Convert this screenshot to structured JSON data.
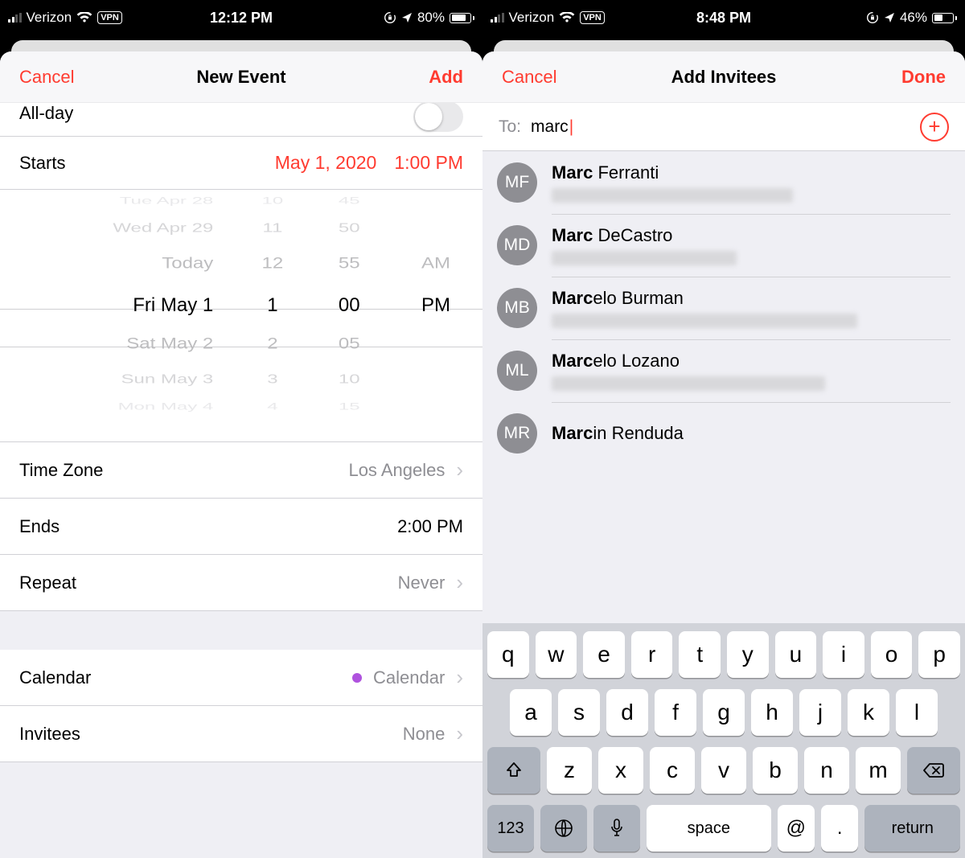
{
  "left": {
    "status": {
      "carrier": "Verizon",
      "vpn": "VPN",
      "time": "12:12 PM",
      "battery_pct": "80%"
    },
    "header": {
      "cancel": "Cancel",
      "title": "New Event",
      "action": "Add"
    },
    "allday_label": "All-day",
    "starts": {
      "label": "Starts",
      "date": "May 1, 2020",
      "time": "1:00 PM"
    },
    "picker": {
      "dates": [
        "Tue Apr 28",
        "Wed Apr 29",
        "Today",
        "Fri May 1",
        "Sat May 2",
        "Sun May 3",
        "Mon May 4"
      ],
      "hours": [
        "10",
        "11",
        "12",
        "1",
        "2",
        "3",
        "4"
      ],
      "mins": [
        "45",
        "50",
        "55",
        "00",
        "05",
        "10",
        "15"
      ],
      "ampm": [
        "AM",
        "PM"
      ]
    },
    "timezone": {
      "label": "Time Zone",
      "value": "Los Angeles"
    },
    "ends": {
      "label": "Ends",
      "value": "2:00 PM"
    },
    "repeat": {
      "label": "Repeat",
      "value": "Never"
    },
    "calendar": {
      "label": "Calendar",
      "value": "Calendar"
    },
    "invitees": {
      "label": "Invitees",
      "value": "None"
    }
  },
  "right": {
    "status": {
      "carrier": "Verizon",
      "vpn": "VPN",
      "time": "8:48 PM",
      "battery_pct": "46%"
    },
    "header": {
      "cancel": "Cancel",
      "title": "Add Invitees",
      "action": "Done"
    },
    "to": {
      "label": "To:",
      "value": "marc"
    },
    "contacts": [
      {
        "initials": "MF",
        "bold": "Marc",
        "rest": " Ferranti"
      },
      {
        "initials": "MD",
        "bold": "Marc",
        "rest": " DeCastro"
      },
      {
        "initials": "MB",
        "bold": "Marc",
        "rest": "elo Burman"
      },
      {
        "initials": "ML",
        "bold": "Marc",
        "rest": "elo Lozano"
      },
      {
        "initials": "MR",
        "bold": "Marc",
        "rest": "in Renduda"
      }
    ],
    "keyboard": {
      "row1": [
        "q",
        "w",
        "e",
        "r",
        "t",
        "y",
        "u",
        "i",
        "o",
        "p"
      ],
      "row2": [
        "a",
        "s",
        "d",
        "f",
        "g",
        "h",
        "j",
        "k",
        "l"
      ],
      "row3": [
        "z",
        "x",
        "c",
        "v",
        "b",
        "n",
        "m"
      ],
      "numkey": "123",
      "space": "space",
      "at": "@",
      "dot": ".",
      "return": "return"
    }
  }
}
